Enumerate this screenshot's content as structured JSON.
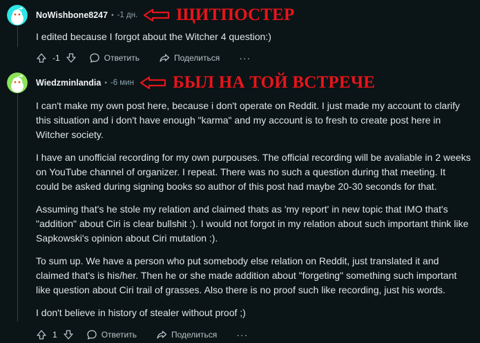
{
  "comment1": {
    "username": "NoWishbone8247",
    "time": "-1 дн.",
    "annotation": "ЩИТПОСТЕР",
    "paragraphs": [
      "I edited because I forgot about the Witcher 4 question:)"
    ],
    "votes": "-1",
    "reply_label": "Ответить",
    "share_label": "Поделиться",
    "more_label": "···",
    "avatar_color": "#2ee6e6"
  },
  "comment2": {
    "username": "Wiedzminlandia",
    "time": "-6 мин",
    "annotation": "БЫЛ НА ТОЙ ВСТРЕЧЕ",
    "paragraphs": [
      "I can't make my own post here, because i don't operate on Reddit. I just made my account to clarify this situation and i don't have enough \"karma\" and my account is to fresh to create post here in Witcher society.",
      "I have an unofficial recording for my own purpouses. The official recording will be avaliable in 2 weeks on YouTube channel of organizer. I repeat. There was no such a question during that meeting. It could be asked during signing books so author of this post had maybe 20-30 seconds for that.",
      "Assuming that's he stole my relation and claimed thats as 'my report' in new topic that IMO that's \"addition\" about Ciri is clear bullshit :). I would not forgot in my relation about such important think like Sapkowski's opinion about Ciri mutation :).",
      "To sum up. We have a person who put somebody else relation on Reddit, just translated it and claimed that's is his/her. Then he or she made addition about \"forgeting\" something such important like question about Ciri trail of grasses. Also there is no proof such like recording, just his words.",
      "I don't believe in history of stealer without proof ;)"
    ],
    "votes": "1",
    "reply_label": "Ответить",
    "share_label": "Поделиться",
    "more_label": "···",
    "avatar_color": "#8ce35a"
  },
  "colors": {
    "background": "#0b1416",
    "annotation_red": "#e8141b",
    "muted_text": "#8ba2ad"
  },
  "icons": [
    "upvote-icon",
    "downvote-icon",
    "comment-bubble-icon",
    "share-icon",
    "more-options-icon",
    "red-arrow-icon"
  ]
}
